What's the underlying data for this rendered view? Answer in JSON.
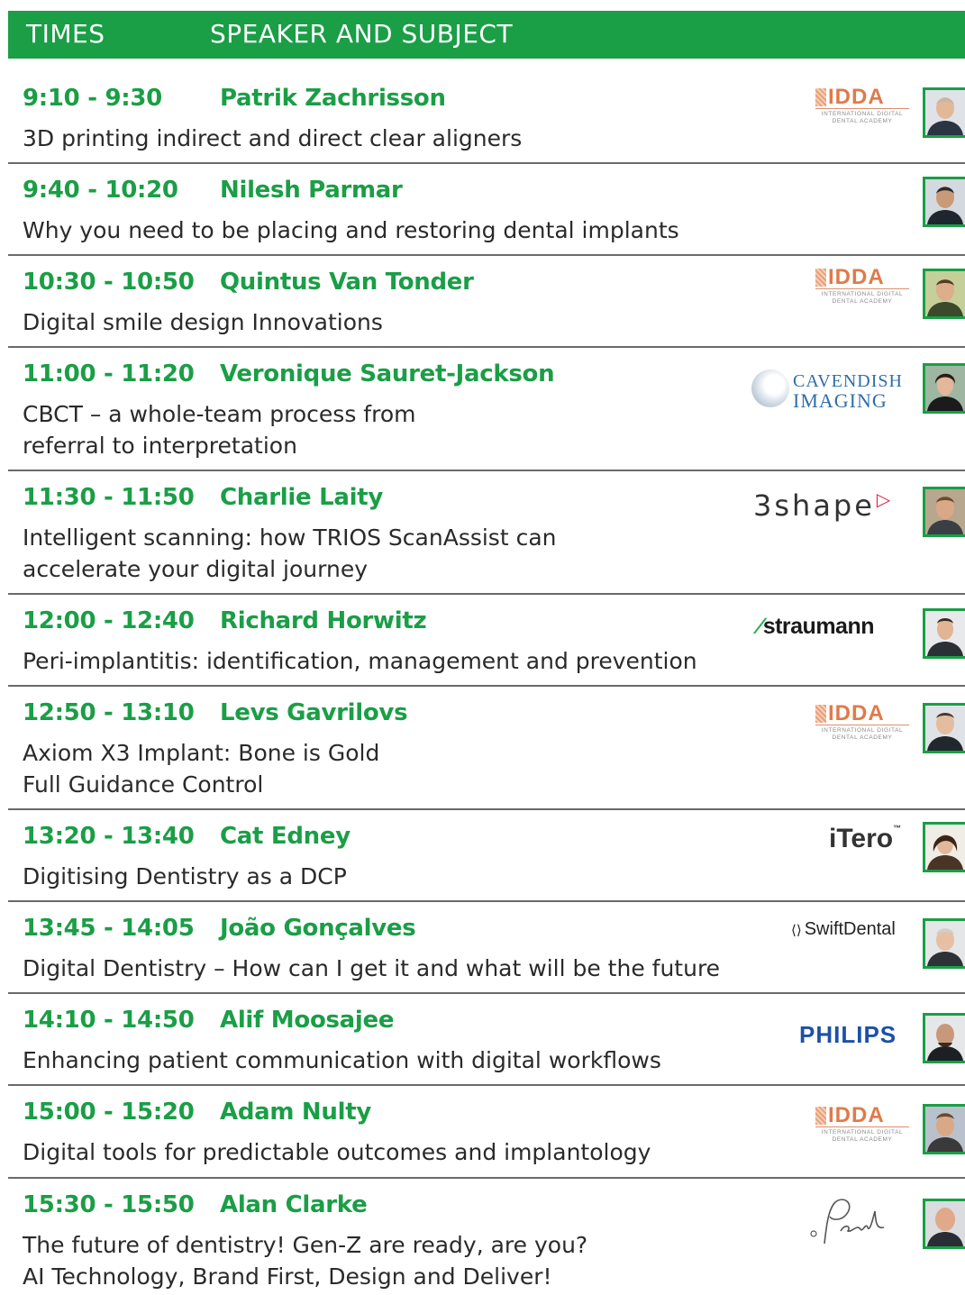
{
  "header": {
    "times_label": "TIMES",
    "speaker_label": "SPEAKER AND SUBJECT"
  },
  "colors": {
    "accent_green": "#1a9e46",
    "divider": "#6a6a6a"
  },
  "sessions": [
    {
      "time": "9:10 - 9:30",
      "speaker": "Patrik Zachrisson",
      "subject": [
        "3D printing indirect and direct clear aligners"
      ],
      "logo": "IDDA"
    },
    {
      "time": "9:40 - 10:20",
      "speaker": "Nilesh Parmar",
      "subject": [
        "Why you need to be placing and restoring dental implants"
      ],
      "logo": ""
    },
    {
      "time": "10:30 - 10:50",
      "speaker": "Quintus Van Tonder",
      "subject": [
        "Digital smile design Innovations"
      ],
      "logo": "IDDA"
    },
    {
      "time": "11:00 - 11:20",
      "speaker": "Veronique Sauret-Jackson",
      "subject": [
        "CBCT – a whole-team process from",
        "referral to interpretation"
      ],
      "logo": "CAVENDISH IMAGING"
    },
    {
      "time": "11:30 - 11:50",
      "speaker": "Charlie Laity",
      "subject": [
        "Intelligent scanning: how TRIOS ScanAssist can",
        "accelerate your digital journey"
      ],
      "logo": "3shape"
    },
    {
      "time": "12:00 - 12:40",
      "speaker": "Richard Horwitz",
      "subject": [
        "Peri-implantitis: identification, management and prevention"
      ],
      "logo": "straumann"
    },
    {
      "time": "12:50 - 13:10",
      "speaker": "Levs Gavrilovs",
      "subject": [
        "Axiom X3 Implant: Bone is Gold",
        "Full Guidance Control"
      ],
      "logo": "IDDA"
    },
    {
      "time": "13:20 - 13:40",
      "speaker": "Cat Edney",
      "subject": [
        "Digitising Dentistry as a DCP"
      ],
      "logo": "iTero"
    },
    {
      "time": "13:45 - 14:05",
      "speaker": "João Gonçalves",
      "subject": [
        "Digital Dentistry – How can I get it and what will be the future"
      ],
      "logo": "SwiftDental"
    },
    {
      "time": "14:10 - 14:50",
      "speaker": "Alif Moosajee",
      "subject": [
        "Enhancing patient communication with digital workflows"
      ],
      "logo": "PHILIPS"
    },
    {
      "time": "15:00 - 15:20",
      "speaker": "Adam Nulty",
      "subject": [
        "Digital tools for predictable outcomes and implantology"
      ],
      "logo": "IDDA"
    },
    {
      "time": "15:30 -  15:50",
      "speaker": "Alan Clarke",
      "subject": [
        "The future of dentistry! Gen-Z are ready, are you?",
        "AI Technology, Brand First, Design and Deliver!"
      ],
      "logo": "Pearl"
    }
  ],
  "logos": {
    "idda": {
      "main": "IDDA",
      "sub_line1": "INTERNATIONAL DIGITAL",
      "sub_line2": "DENTAL ACADEMY"
    },
    "cavendish": {
      "line1": "CAVENDISH",
      "line2": "IMAGING"
    },
    "threeshape": {
      "text": "3shape"
    },
    "straumann": {
      "text": "straumann"
    },
    "itero": {
      "text": "iTero",
      "tm": "™"
    },
    "swift": {
      "text": "SwiftDental"
    },
    "philips": {
      "text": "PHILIPS"
    }
  }
}
